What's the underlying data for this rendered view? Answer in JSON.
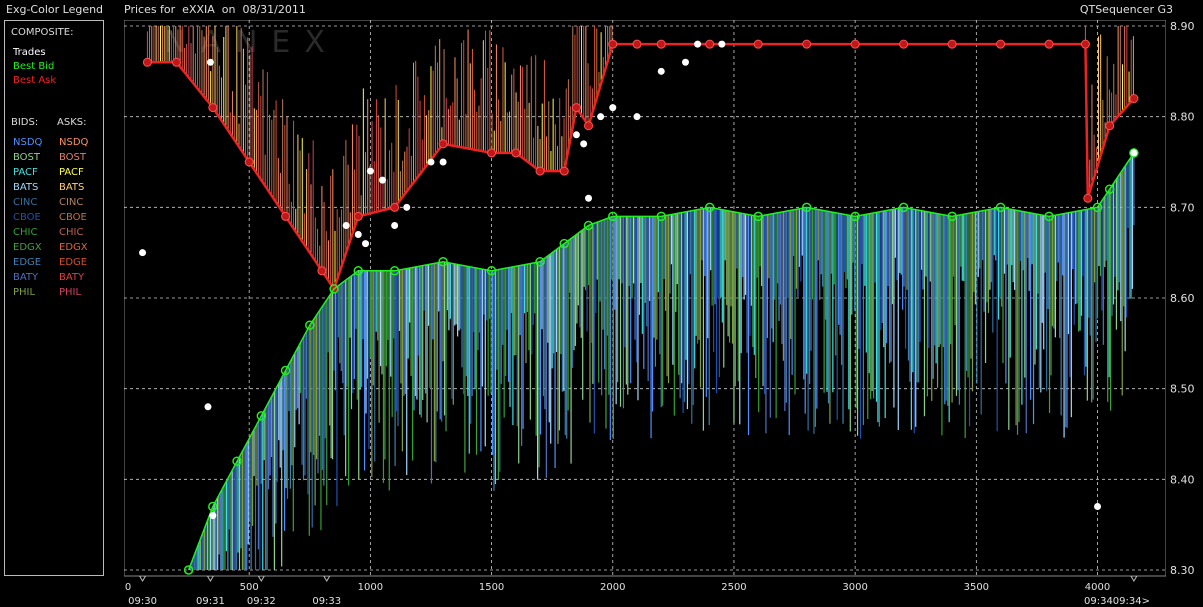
{
  "header": {
    "legend_title": "Exg-Color Legend",
    "chart_title": "Prices for  eXXIA  on  08/31/2011",
    "app_name": "QTSequencer G3"
  },
  "legend": {
    "composite_label": "COMPOSITE:",
    "composite": [
      {
        "label": "Trades",
        "color": "#ffffff"
      },
      {
        "label": "Best Bid",
        "color": "#22ee22"
      },
      {
        "label": "Best Ask",
        "color": "#ee2222"
      }
    ],
    "bids_label": "BIDS:",
    "asks_label": "ASKS:",
    "bids": [
      {
        "label": "NSDQ",
        "color": "#4f8fff"
      },
      {
        "label": "BOST",
        "color": "#8fd08f"
      },
      {
        "label": "PACF",
        "color": "#40e0e0"
      },
      {
        "label": "BATS",
        "color": "#a0d8ff"
      },
      {
        "label": "CINC",
        "color": "#3070a0"
      },
      {
        "label": "CBOE",
        "color": "#2050b0"
      },
      {
        "label": "CHIC",
        "color": "#30a030"
      },
      {
        "label": "EDGX",
        "color": "#40a040"
      },
      {
        "label": "EDGE",
        "color": "#4080b0"
      },
      {
        "label": "BATY",
        "color": "#5070c0"
      },
      {
        "label": "PHIL",
        "color": "#80a040"
      }
    ],
    "asks": [
      {
        "label": "NSDQ",
        "color": "#ff9060"
      },
      {
        "label": "BOST",
        "color": "#e08070"
      },
      {
        "label": "PACF",
        "color": "#ffff40"
      },
      {
        "label": "BATS",
        "color": "#ffd070"
      },
      {
        "label": "CINC",
        "color": "#b08060"
      },
      {
        "label": "CBOE",
        "color": "#c07040"
      },
      {
        "label": "CHIC",
        "color": "#c06050"
      },
      {
        "label": "EDGX",
        "color": "#e06040"
      },
      {
        "label": "EDGE",
        "color": "#d05030"
      },
      {
        "label": "BATY",
        "color": "#e04040"
      },
      {
        "label": "PHIL",
        "color": "#d04060"
      }
    ]
  },
  "chart_data": {
    "type": "line",
    "watermark": "NANEX",
    "x_ticks": [
      0,
      500,
      1000,
      1500,
      2000,
      2500,
      3000,
      3500,
      4000
    ],
    "x_range": [
      0,
      4200
    ],
    "time_labels": [
      {
        "x": 60,
        "label": "09:30"
      },
      {
        "x": 340,
        "label": "09:31"
      },
      {
        "x": 550,
        "label": "09:32"
      },
      {
        "x": 820,
        "label": "09:33"
      },
      {
        "x": 4150,
        "label": "09:3409:34>"
      }
    ],
    "y_ticks": [
      "8.30",
      "8.40",
      "8.50",
      "8.60",
      "8.70",
      "8.80",
      "8.90"
    ],
    "y_range": [
      8.3,
      8.9
    ],
    "best_ask": {
      "x": [
        80,
        200,
        350,
        500,
        650,
        800,
        850,
        950,
        1100,
        1300,
        1500,
        1600,
        1700,
        1800,
        1850,
        1900,
        2000,
        2100,
        2200,
        2400,
        2600,
        2800,
        3000,
        3200,
        3400,
        3600,
        3800,
        3950,
        3960,
        4050,
        4150
      ],
      "y": [
        8.86,
        8.86,
        8.81,
        8.75,
        8.69,
        8.63,
        8.61,
        8.69,
        8.7,
        8.77,
        8.76,
        8.76,
        8.74,
        8.74,
        8.81,
        8.79,
        8.88,
        8.88,
        8.88,
        8.88,
        8.88,
        8.88,
        8.88,
        8.88,
        8.88,
        8.88,
        8.88,
        8.88,
        8.71,
        8.79,
        8.82
      ]
    },
    "best_bid": {
      "x": [
        250,
        350,
        450,
        550,
        650,
        750,
        850,
        950,
        1100,
        1300,
        1500,
        1700,
        1800,
        1900,
        2000,
        2200,
        2400,
        2600,
        2800,
        3000,
        3200,
        3400,
        3600,
        3800,
        4000,
        4050,
        4150
      ],
      "y": [
        8.3,
        8.37,
        8.42,
        8.47,
        8.52,
        8.57,
        8.61,
        8.63,
        8.63,
        8.64,
        8.63,
        8.64,
        8.66,
        8.68,
        8.69,
        8.69,
        8.7,
        8.69,
        8.7,
        8.69,
        8.7,
        8.69,
        8.7,
        8.69,
        8.7,
        8.72,
        8.76
      ]
    },
    "trades": {
      "x": [
        60,
        330,
        340,
        350,
        900,
        950,
        980,
        1000,
        1050,
        1100,
        1150,
        1250,
        1300,
        1850,
        1880,
        1900,
        1950,
        2000,
        2100,
        2200,
        2300,
        2350,
        2450,
        4000,
        4150
      ],
      "y": [
        8.65,
        8.48,
        8.86,
        8.36,
        8.68,
        8.67,
        8.66,
        8.74,
        8.73,
        8.68,
        8.7,
        8.75,
        8.75,
        8.78,
        8.77,
        8.71,
        8.8,
        8.81,
        8.8,
        8.85,
        8.86,
        8.88,
        8.88,
        8.37,
        8.76
      ]
    }
  }
}
